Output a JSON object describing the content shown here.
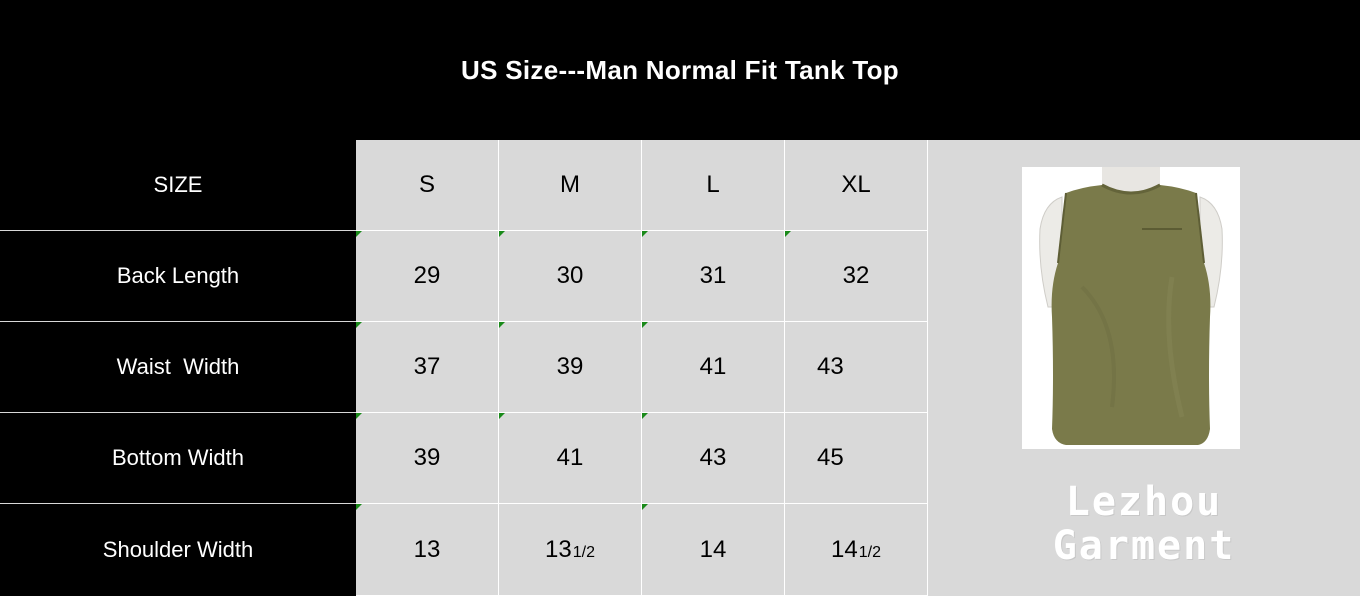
{
  "title": "US Size---Man Normal Fit Tank Top",
  "table": {
    "header": {
      "label": "SIZE",
      "sizes": [
        "S",
        "M",
        "L",
        "XL"
      ]
    },
    "rows": [
      {
        "label": "Back Length",
        "values": [
          "29",
          "30",
          "31",
          "32"
        ]
      },
      {
        "label": "Waist  Width",
        "values": [
          "37",
          "39",
          "41",
          "43"
        ]
      },
      {
        "label": "Bottom Width",
        "values": [
          "39",
          "41",
          "43",
          "45"
        ]
      },
      {
        "label": "Shoulder Width",
        "values": [
          "13",
          "13",
          "14",
          "14"
        ],
        "fractions": [
          "",
          "1/2",
          "",
          "1/2"
        ]
      }
    ]
  },
  "product_image": {
    "description_icon": "tank-top-image",
    "garment_color": "#7a7a4a"
  },
  "watermark": {
    "line1": "Lezhou",
    "line2": "Garment"
  },
  "colors": {
    "header_bg": "#000000",
    "cell_bg": "#d9d9d9",
    "corner_marker": "#1a8a1a"
  }
}
